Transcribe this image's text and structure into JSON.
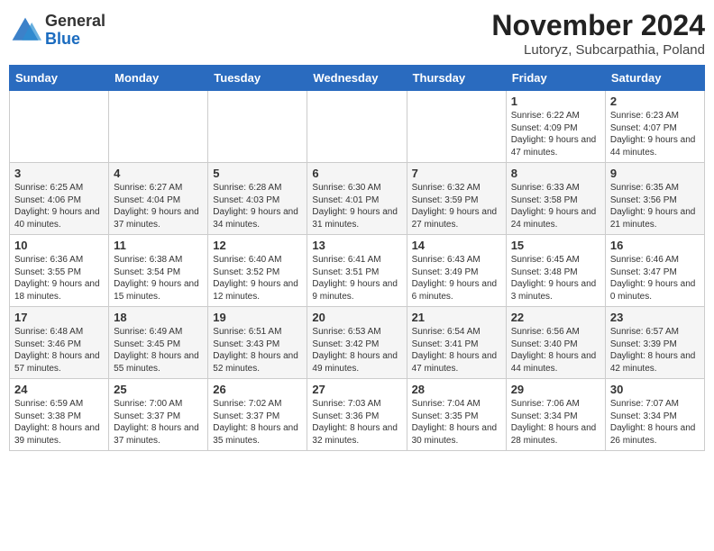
{
  "header": {
    "logo_general": "General",
    "logo_blue": "Blue",
    "month_title": "November 2024",
    "location": "Lutoryz, Subcarpathia, Poland"
  },
  "weekdays": [
    "Sunday",
    "Monday",
    "Tuesday",
    "Wednesday",
    "Thursday",
    "Friday",
    "Saturday"
  ],
  "weeks": [
    [
      {
        "day": "",
        "info": ""
      },
      {
        "day": "",
        "info": ""
      },
      {
        "day": "",
        "info": ""
      },
      {
        "day": "",
        "info": ""
      },
      {
        "day": "",
        "info": ""
      },
      {
        "day": "1",
        "info": "Sunrise: 6:22 AM\nSunset: 4:09 PM\nDaylight: 9 hours and 47 minutes."
      },
      {
        "day": "2",
        "info": "Sunrise: 6:23 AM\nSunset: 4:07 PM\nDaylight: 9 hours and 44 minutes."
      }
    ],
    [
      {
        "day": "3",
        "info": "Sunrise: 6:25 AM\nSunset: 4:06 PM\nDaylight: 9 hours and 40 minutes."
      },
      {
        "day": "4",
        "info": "Sunrise: 6:27 AM\nSunset: 4:04 PM\nDaylight: 9 hours and 37 minutes."
      },
      {
        "day": "5",
        "info": "Sunrise: 6:28 AM\nSunset: 4:03 PM\nDaylight: 9 hours and 34 minutes."
      },
      {
        "day": "6",
        "info": "Sunrise: 6:30 AM\nSunset: 4:01 PM\nDaylight: 9 hours and 31 minutes."
      },
      {
        "day": "7",
        "info": "Sunrise: 6:32 AM\nSunset: 3:59 PM\nDaylight: 9 hours and 27 minutes."
      },
      {
        "day": "8",
        "info": "Sunrise: 6:33 AM\nSunset: 3:58 PM\nDaylight: 9 hours and 24 minutes."
      },
      {
        "day": "9",
        "info": "Sunrise: 6:35 AM\nSunset: 3:56 PM\nDaylight: 9 hours and 21 minutes."
      }
    ],
    [
      {
        "day": "10",
        "info": "Sunrise: 6:36 AM\nSunset: 3:55 PM\nDaylight: 9 hours and 18 minutes."
      },
      {
        "day": "11",
        "info": "Sunrise: 6:38 AM\nSunset: 3:54 PM\nDaylight: 9 hours and 15 minutes."
      },
      {
        "day": "12",
        "info": "Sunrise: 6:40 AM\nSunset: 3:52 PM\nDaylight: 9 hours and 12 minutes."
      },
      {
        "day": "13",
        "info": "Sunrise: 6:41 AM\nSunset: 3:51 PM\nDaylight: 9 hours and 9 minutes."
      },
      {
        "day": "14",
        "info": "Sunrise: 6:43 AM\nSunset: 3:49 PM\nDaylight: 9 hours and 6 minutes."
      },
      {
        "day": "15",
        "info": "Sunrise: 6:45 AM\nSunset: 3:48 PM\nDaylight: 9 hours and 3 minutes."
      },
      {
        "day": "16",
        "info": "Sunrise: 6:46 AM\nSunset: 3:47 PM\nDaylight: 9 hours and 0 minutes."
      }
    ],
    [
      {
        "day": "17",
        "info": "Sunrise: 6:48 AM\nSunset: 3:46 PM\nDaylight: 8 hours and 57 minutes."
      },
      {
        "day": "18",
        "info": "Sunrise: 6:49 AM\nSunset: 3:45 PM\nDaylight: 8 hours and 55 minutes."
      },
      {
        "day": "19",
        "info": "Sunrise: 6:51 AM\nSunset: 3:43 PM\nDaylight: 8 hours and 52 minutes."
      },
      {
        "day": "20",
        "info": "Sunrise: 6:53 AM\nSunset: 3:42 PM\nDaylight: 8 hours and 49 minutes."
      },
      {
        "day": "21",
        "info": "Sunrise: 6:54 AM\nSunset: 3:41 PM\nDaylight: 8 hours and 47 minutes."
      },
      {
        "day": "22",
        "info": "Sunrise: 6:56 AM\nSunset: 3:40 PM\nDaylight: 8 hours and 44 minutes."
      },
      {
        "day": "23",
        "info": "Sunrise: 6:57 AM\nSunset: 3:39 PM\nDaylight: 8 hours and 42 minutes."
      }
    ],
    [
      {
        "day": "24",
        "info": "Sunrise: 6:59 AM\nSunset: 3:38 PM\nDaylight: 8 hours and 39 minutes."
      },
      {
        "day": "25",
        "info": "Sunrise: 7:00 AM\nSunset: 3:37 PM\nDaylight: 8 hours and 37 minutes."
      },
      {
        "day": "26",
        "info": "Sunrise: 7:02 AM\nSunset: 3:37 PM\nDaylight: 8 hours and 35 minutes."
      },
      {
        "day": "27",
        "info": "Sunrise: 7:03 AM\nSunset: 3:36 PM\nDaylight: 8 hours and 32 minutes."
      },
      {
        "day": "28",
        "info": "Sunrise: 7:04 AM\nSunset: 3:35 PM\nDaylight: 8 hours and 30 minutes."
      },
      {
        "day": "29",
        "info": "Sunrise: 7:06 AM\nSunset: 3:34 PM\nDaylight: 8 hours and 28 minutes."
      },
      {
        "day": "30",
        "info": "Sunrise: 7:07 AM\nSunset: 3:34 PM\nDaylight: 8 hours and 26 minutes."
      }
    ]
  ]
}
